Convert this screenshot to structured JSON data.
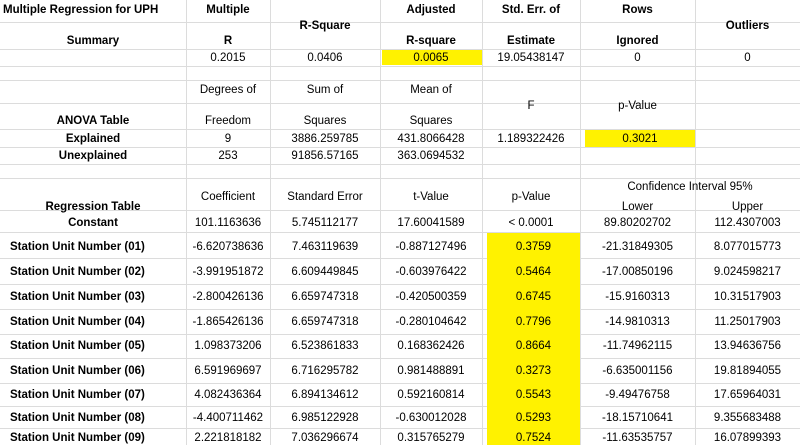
{
  "summary": {
    "title": "Multiple Regression for UPH",
    "label": "Summary",
    "headers": {
      "multiple_top": "Multiple",
      "multiple_bottom": "R",
      "rsquare": "R-Square",
      "adj_top": "Adjusted",
      "adj_bottom": "R-square",
      "stderr_top": "Std. Err. of",
      "stderr_bottom": "Estimate",
      "rows_top": "Rows",
      "rows_bottom": "Ignored",
      "outliers": "Outliers"
    },
    "values": {
      "multiple_r": "0.2015",
      "r_square": "0.0406",
      "adj_r_square": "0.0065",
      "std_err": "19.05438147",
      "rows_ignored": "0",
      "outliers": "0"
    }
  },
  "anova": {
    "label": "ANOVA Table",
    "headers": {
      "df_top": "Degrees of",
      "df_bottom": "Freedom",
      "ss_top": "Sum of",
      "ss_bottom": "Squares",
      "ms_top": "Mean of",
      "ms_bottom": "Squares",
      "f": "F",
      "p": "p-Value"
    },
    "rows": [
      {
        "label": "Explained",
        "df": "9",
        "ss": "3886.259785",
        "ms": "431.8066428",
        "f": "1.189322426",
        "p": "0.3021"
      },
      {
        "label": "Unexplained",
        "df": "253",
        "ss": "91856.57165",
        "ms": "363.0694532",
        "f": "",
        "p": ""
      }
    ]
  },
  "regression": {
    "label": "Regression Table",
    "headers": {
      "coef": "Coefficient",
      "se": "Standard Error",
      "t": "t-Value",
      "p": "p-Value",
      "ci": "Confidence Interval 95%",
      "lower": "Lower",
      "upper": "Upper"
    },
    "rows": [
      {
        "label": "Constant",
        "coef": "101.1163636",
        "se": "5.745112177",
        "t": "17.60041589",
        "p": "< 0.0001",
        "lower": "89.80202702",
        "upper": "112.4307003"
      },
      {
        "label": "Station Unit Number (01)",
        "coef": "-6.620738636",
        "se": "7.463119639",
        "t": "-0.887127496",
        "p": "0.3759",
        "lower": "-21.31849305",
        "upper": "8.077015773"
      },
      {
        "label": "Station Unit Number (02)",
        "coef": "-3.991951872",
        "se": "6.609449845",
        "t": "-0.603976422",
        "p": "0.5464",
        "lower": "-17.00850196",
        "upper": "9.024598217"
      },
      {
        "label": "Station Unit Number (03)",
        "coef": "-2.800426136",
        "se": "6.659747318",
        "t": "-0.420500359",
        "p": "0.6745",
        "lower": "-15.9160313",
        "upper": "10.31517903"
      },
      {
        "label": "Station Unit Number (04)",
        "coef": "-1.865426136",
        "se": "6.659747318",
        "t": "-0.280104642",
        "p": "0.7796",
        "lower": "-14.9810313",
        "upper": "11.25017903"
      },
      {
        "label": "Station Unit Number (05)",
        "coef": "1.098373206",
        "se": "6.523861833",
        "t": "0.168362426",
        "p": "0.8664",
        "lower": "-11.74962115",
        "upper": "13.94636756"
      },
      {
        "label": "Station Unit Number (06)",
        "coef": "6.591969697",
        "se": "6.716295782",
        "t": "0.981488891",
        "p": "0.3273",
        "lower": "-6.635001156",
        "upper": "19.81894055"
      },
      {
        "label": "Station Unit Number (07)",
        "coef": "4.082436364",
        "se": "6.894134612",
        "t": "0.592160814",
        "p": "0.5543",
        "lower": "-9.49476758",
        "upper": "17.65964031"
      },
      {
        "label": "Station Unit Number (08)",
        "coef": "-4.400711462",
        "se": "6.985122928",
        "t": "-0.630012028",
        "p": "0.5293",
        "lower": "-18.15710641",
        "upper": "9.355683488"
      },
      {
        "label": "Station Unit Number (09)",
        "coef": "2.221818182",
        "se": "7.036296674",
        "t": "0.315765279",
        "p": "0.7524",
        "lower": "-11.63535757",
        "upper": "16.07899393"
      }
    ]
  },
  "colors": {
    "highlight": "#fff200",
    "grid": "#dcdcdc"
  }
}
